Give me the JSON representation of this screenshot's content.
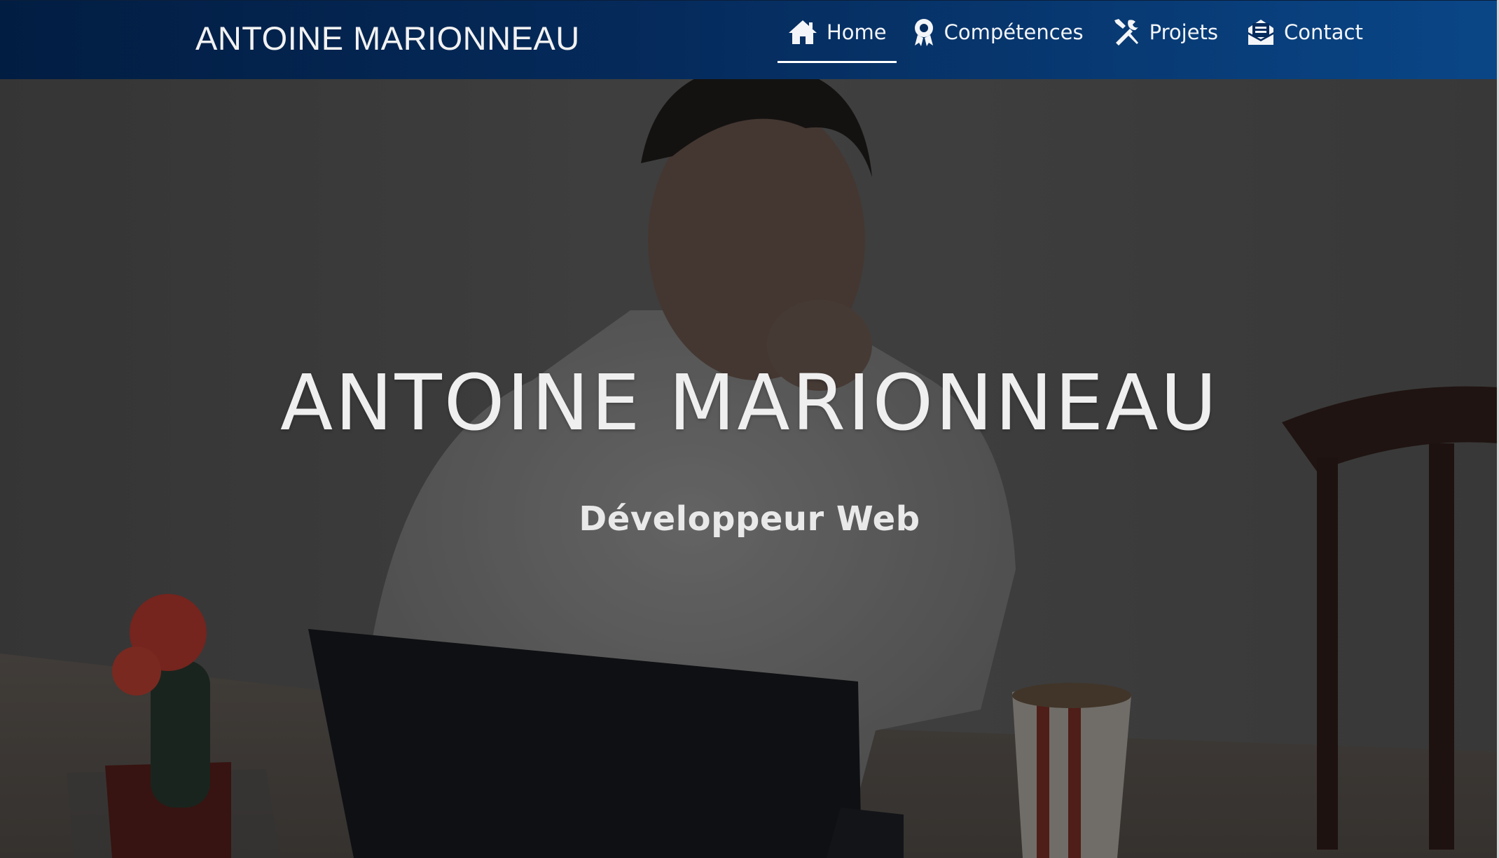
{
  "navbar": {
    "brand": "ANTOINE MARIONNEAU",
    "items": [
      {
        "label": "Home",
        "icon": "home-icon",
        "active": true
      },
      {
        "label": "Compétences",
        "icon": "award-icon",
        "active": false
      },
      {
        "label": "Projets",
        "icon": "tools-icon",
        "active": false
      },
      {
        "label": "Contact",
        "icon": "envelope-icon",
        "active": false
      }
    ]
  },
  "hero": {
    "title": "ANTOINE MARIONNEAU",
    "subtitle": "Développeur Web"
  },
  "colors": {
    "navbar_start": "#021d42",
    "navbar_end": "#0a4687",
    "text": "#f3f5f8"
  }
}
